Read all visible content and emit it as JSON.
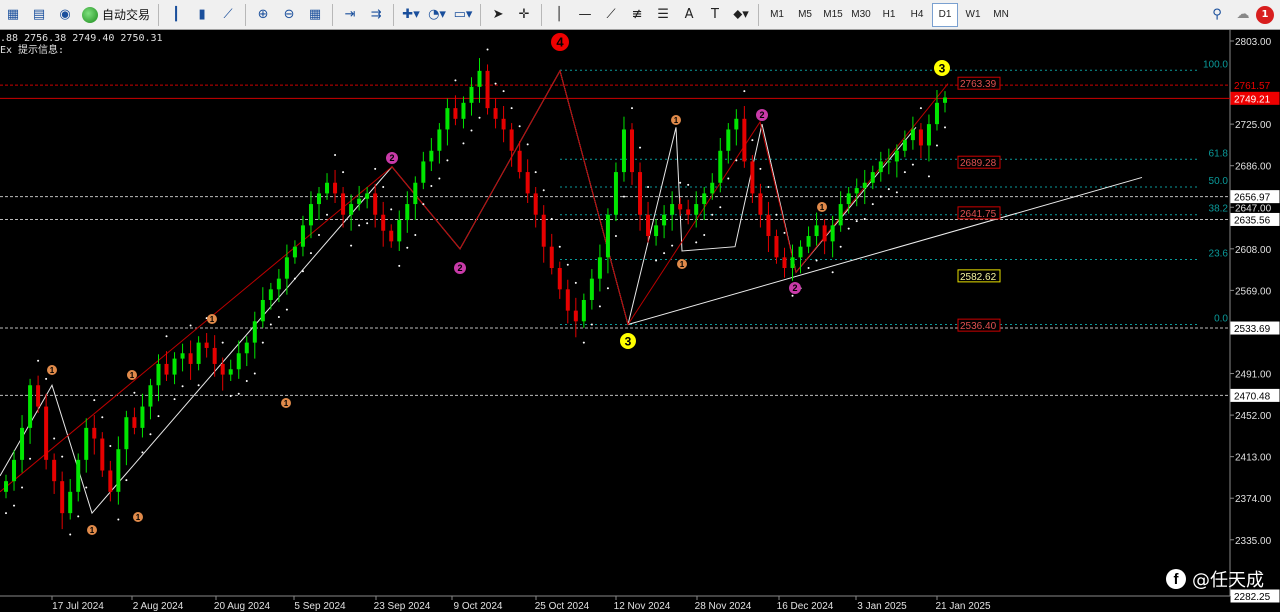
{
  "toolbar": {
    "autotrade_label": "自动交易",
    "timeframes": [
      "M1",
      "M5",
      "M15",
      "M30",
      "H1",
      "H4",
      "D1",
      "W1",
      "MN"
    ],
    "active_timeframe": "D1",
    "notification_count": "1"
  },
  "info": {
    "ohlc": ".88 2756.38 2749.40 2750.31",
    "indicator_label": "Ex 提示信息:"
  },
  "watermark": {
    "text": "@任天成"
  },
  "colors": {
    "bull": "#00e600",
    "bear": "#e60000",
    "fib": "#0a9a9a"
  },
  "chart_data": {
    "type": "candlestick",
    "y_range": [
      2282.25,
      2803.0
    ],
    "price_ticks": [
      "2803.00",
      "2725.00",
      "2686.00",
      "2647.00",
      "2608.00",
      "2569.00",
      "2491.00",
      "2452.00",
      "2413.00",
      "2374.00",
      "2335.00"
    ],
    "date_labels": [
      "17 Jul 2024",
      "2 Aug 2024",
      "20 Aug 2024",
      "5 Sep 2024",
      "23 Sep 2024",
      "9 Oct 2024",
      "25 Oct 2024",
      "12 Nov 2024",
      "28 Nov 2024",
      "16 Dec 2024",
      "3 Jan 2025",
      "21 Jan 2025"
    ],
    "price_tags": [
      {
        "text": "2761.57",
        "value": 2761.57,
        "style": "red-text"
      },
      {
        "text": "2749.21",
        "value": 2749.21,
        "style": "red-fill"
      },
      {
        "text": "2656.97",
        "value": 2656.97,
        "style": "white"
      },
      {
        "text": "2635.56",
        "value": 2635.56,
        "style": "white"
      },
      {
        "text": "2533.69",
        "value": 2533.69,
        "style": "white"
      },
      {
        "text": "2470.48",
        "value": 2470.48,
        "style": "white"
      },
      {
        "text": "2282.25",
        "value": 2282.25,
        "style": "white"
      }
    ],
    "fib_levels": [
      {
        "label": "100.0",
        "value": 2775.5
      },
      {
        "label": "61.8",
        "value": 2692
      },
      {
        "label": "50.0",
        "value": 2666
      },
      {
        "label": "38.2",
        "value": 2640
      },
      {
        "label": "23.6",
        "value": 2598
      },
      {
        "label": "0.0",
        "value": 2537
      }
    ],
    "fib_tags": [
      {
        "text": "2763.39",
        "value": 2763.39,
        "style": "red-box"
      },
      {
        "text": "2689.28",
        "value": 2689.28,
        "style": "red-box"
      },
      {
        "text": "2641.75",
        "value": 2641.75,
        "style": "red-box"
      },
      {
        "text": "2582.62",
        "value": 2582.62,
        "style": "yellow-box"
      },
      {
        "text": "2536.40",
        "value": 2536.4,
        "style": "red-box"
      }
    ],
    "wave_labels": [
      {
        "text": "4",
        "size": "big-red"
      },
      {
        "text": "3",
        "size": "big-yellow"
      },
      {
        "text": "3",
        "size": "big-yellow"
      },
      {
        "text": "2",
        "size": "purple"
      },
      {
        "text": "2",
        "size": "purple"
      },
      {
        "text": "2",
        "size": "purple"
      },
      {
        "text": "2",
        "size": "purple"
      },
      {
        "text": "1",
        "size": "orange"
      },
      {
        "text": "1",
        "size": "orange"
      },
      {
        "text": "1",
        "size": "orange"
      },
      {
        "text": "1",
        "size": "orange"
      },
      {
        "text": "1",
        "size": "orange"
      },
      {
        "text": "1",
        "size": "orange"
      },
      {
        "text": "1",
        "size": "orange"
      },
      {
        "text": "1",
        "size": "orange"
      },
      {
        "text": "1",
        "size": "orange"
      }
    ],
    "closes": [
      2390,
      2410,
      2440,
      2480,
      2460,
      2410,
      2390,
      2360,
      2380,
      2410,
      2440,
      2430,
      2400,
      2380,
      2420,
      2450,
      2440,
      2460,
      2480,
      2500,
      2490,
      2505,
      2510,
      2500,
      2520,
      2515,
      2500,
      2490,
      2495,
      2510,
      2520,
      2540,
      2560,
      2570,
      2580,
      2600,
      2610,
      2630,
      2650,
      2660,
      2670,
      2660,
      2640,
      2650,
      2655,
      2660,
      2640,
      2625,
      2615,
      2635,
      2650,
      2670,
      2690,
      2700,
      2720,
      2740,
      2730,
      2745,
      2760,
      2775,
      2740,
      2730,
      2720,
      2700,
      2680,
      2660,
      2640,
      2610,
      2590,
      2570,
      2550,
      2540,
      2560,
      2580,
      2600,
      2640,
      2680,
      2720,
      2680,
      2640,
      2620,
      2630,
      2640,
      2650,
      2645,
      2640,
      2650,
      2660,
      2670,
      2700,
      2720,
      2730,
      2690,
      2660,
      2640,
      2620,
      2600,
      2590,
      2600,
      2610,
      2620,
      2630,
      2615,
      2630,
      2650,
      2660,
      2665,
      2670,
      2680,
      2690,
      2690,
      2700,
      2710,
      2720,
      2705,
      2725,
      2745,
      2750
    ]
  }
}
